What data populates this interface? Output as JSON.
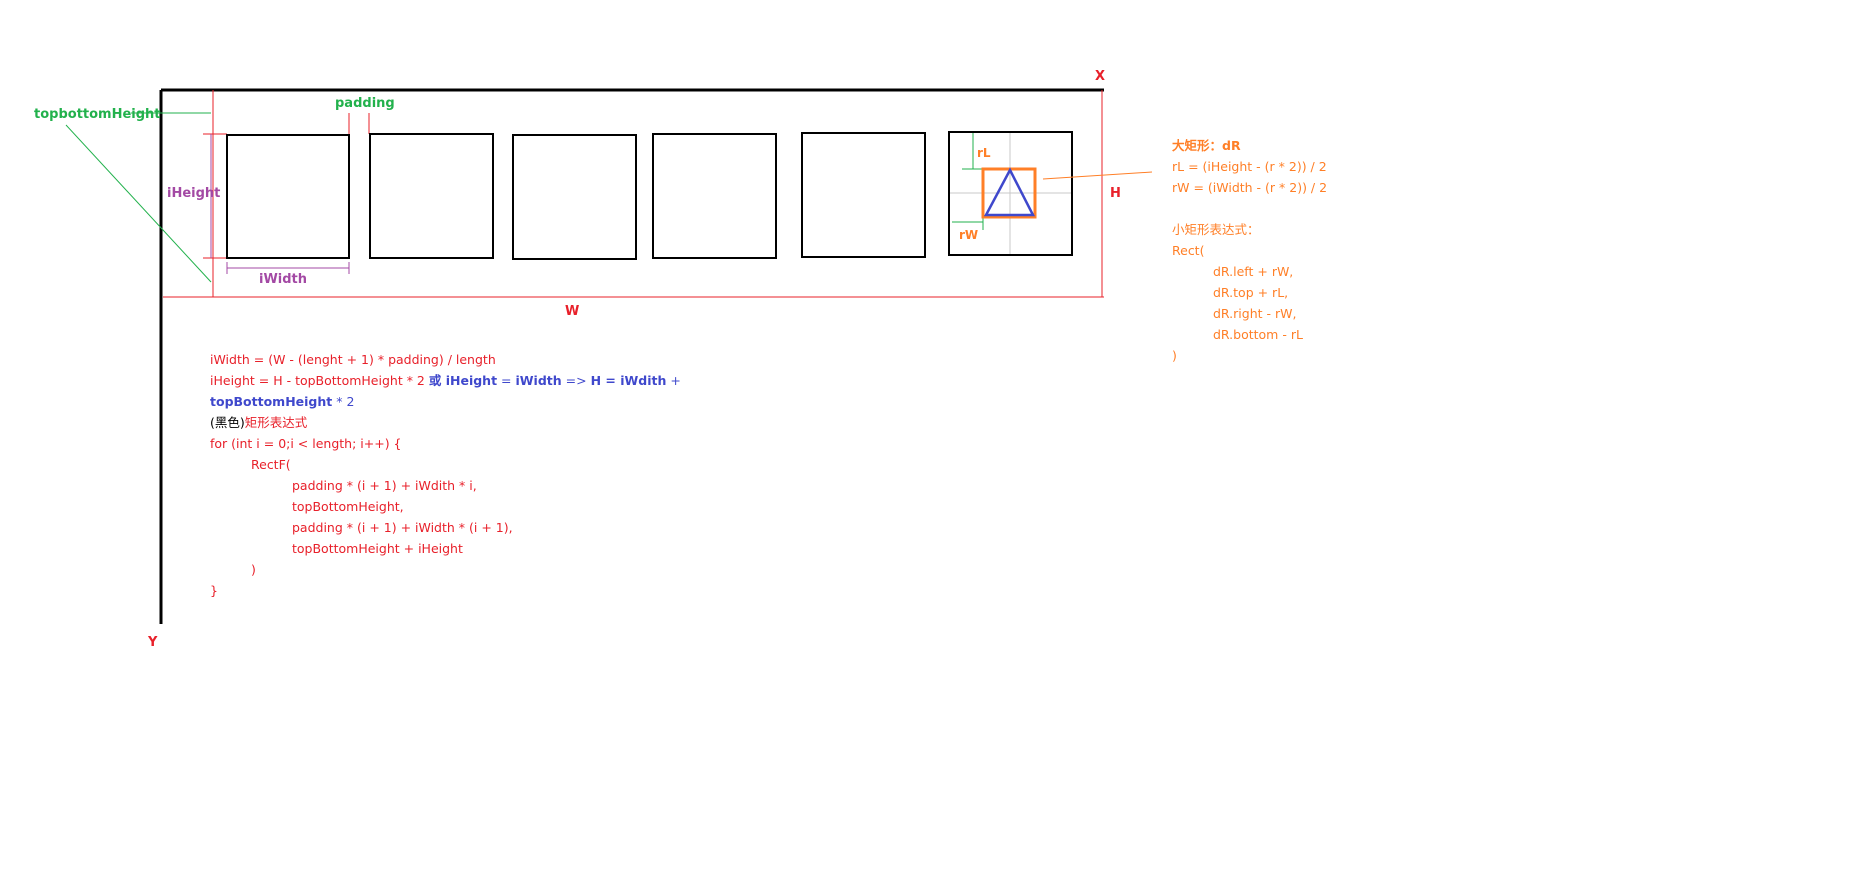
{
  "axes": {
    "x_label": "X",
    "y_label": "Y",
    "w_label": "W",
    "h_label": "H"
  },
  "dims": {
    "top_bottom_height": "topbottomHeight",
    "padding": "padding",
    "i_height": "iHeight",
    "i_width": "iWidth",
    "r_l": "rL",
    "r_w": "rW"
  },
  "formulas": {
    "line1": "iWidth = (W - (lenght + 1) * padding) / length",
    "line2_red": "iHeight = H - topBottomHeight * 2 ",
    "line2_or": "或",
    "line2_blue_bold1": " iHeight",
    "line2_blue1": " = ",
    "line2_blue_bold2": "iWidth",
    "line2_blue2": " => ",
    "line2_blue_bold3": "H = iWdith",
    "line2_blue3": " +",
    "line3_blue_bold": "topBottomHeight",
    "line3_blue": " * 2",
    "line4_black": "(黑色)",
    "line4_red": "矩形表达式",
    "line5": "for (int i = 0;i < length; i++) {",
    "line6": "RectF(",
    "line7": "padding * (i + 1) + iWdith * i,",
    "line8": "topBottomHeight,",
    "line9": "padding * (i + 1) + iWidth * (i + 1),",
    "line10": "topBottomHeight + iHeight",
    "line11": ")",
    "line12": "}"
  },
  "right_notes": {
    "title": "大矩形：dR",
    "rl_formula": "rL = (iHeight - (r * 2)) / 2",
    "rw_formula": "rW = (iWidth - (r * 2)) / 2",
    "small_title": "小矩形表达式：",
    "rect_open": "Rect(",
    "arg1": "dR.left + rW,",
    "arg2": "dR.top + rL,",
    "arg3": "dR.right - rW,",
    "arg4": "dR.bottom - rL",
    "rect_close": ")"
  },
  "colors": {
    "red": "#e8202a",
    "green": "#22b14c",
    "purple": "#a349a4",
    "orange": "#ff7f27",
    "blue": "#3f48cc",
    "black": "#000000"
  }
}
